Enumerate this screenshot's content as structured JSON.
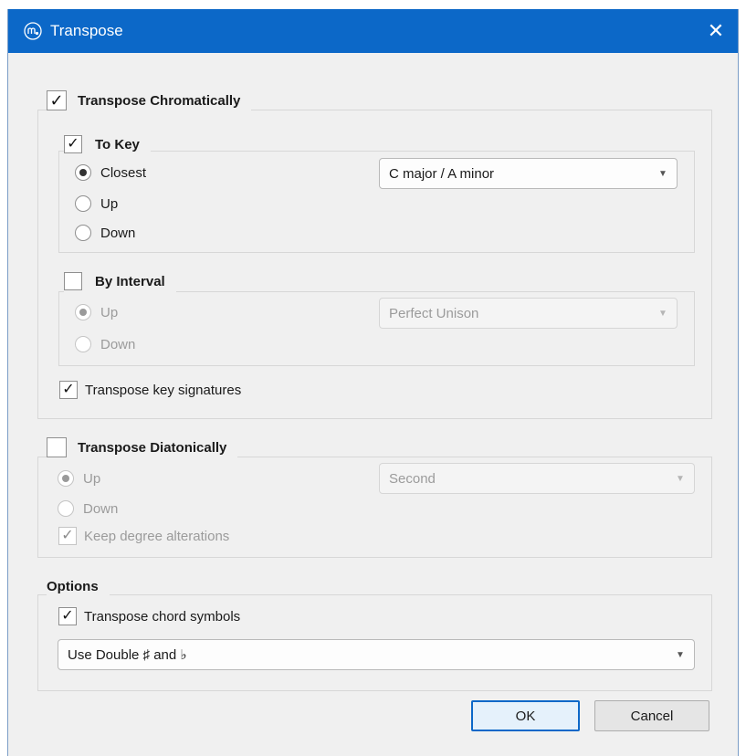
{
  "window": {
    "title": "Transpose",
    "app_icon": "musescore-icon",
    "close_glyph": "✕",
    "accent_color": "#0c68c8"
  },
  "chromatic": {
    "label": "Transpose Chromatically",
    "checked": true,
    "to_key": {
      "label": "To Key",
      "checked": true,
      "options": [
        "Closest",
        "Up",
        "Down"
      ],
      "selected": "Closest",
      "key_value": "C major / A minor"
    },
    "by_interval": {
      "label": "By Interval",
      "checked": false,
      "options": [
        "Up",
        "Down"
      ],
      "selected": "Up",
      "interval_value": "Perfect Unison"
    },
    "key_signatures": {
      "label": "Transpose key signatures",
      "checked": true
    }
  },
  "diatonic": {
    "label": "Transpose Diatonically",
    "checked": false,
    "options": [
      "Up",
      "Down"
    ],
    "selected": "Up",
    "interval_value": "Second",
    "keep_alterations": {
      "label": "Keep degree alterations",
      "checked": true
    }
  },
  "options": {
    "label": "Options",
    "chord_symbols": {
      "label": "Transpose chord symbols",
      "checked": true
    },
    "accidentals_value": "Use Double ♯ and  ♭"
  },
  "buttons": {
    "ok": "OK",
    "cancel": "Cancel"
  },
  "check_glyph": "✓"
}
